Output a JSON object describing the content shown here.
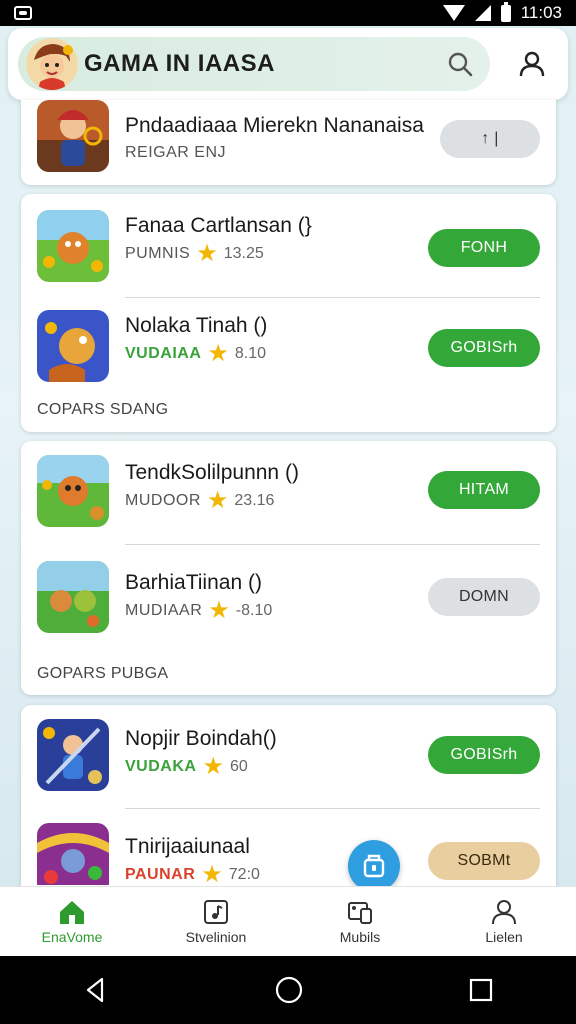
{
  "status_bar": {
    "time": "11:03"
  },
  "header": {
    "title": "GAMA  IN IAASA"
  },
  "top_card": {
    "title": "Pndaadiaaa Mierekn Nananaisa",
    "subtitle": "REIGAR ENJ",
    "button_label": "↑  |"
  },
  "card1": {
    "rows": [
      {
        "title": "Fanaa Cartlansan (}",
        "developer": "PUMNIS",
        "rating": "13.25",
        "button": "FONH"
      },
      {
        "title": "Nolaka Tinah ()",
        "developer": "VUDAIAA",
        "rating": "8.10",
        "button": "GOBISrh"
      }
    ],
    "section_label": "COPARS SDANG"
  },
  "card2": {
    "rows": [
      {
        "title": "TendkSolilpunnn ()",
        "developer": "MUDOOR",
        "rating": "23.16",
        "button": "HITAM"
      },
      {
        "title": "BarhiaTiinan ()",
        "developer": "MUDIAAR",
        "rating": "-8.10",
        "button": "DOMN"
      }
    ],
    "section_label": "GOPARS PUBGA"
  },
  "card3": {
    "rows": [
      {
        "title": "Nopjir Boindah()",
        "developer": "VUDAKA",
        "rating": "60",
        "button": "GOBISrh"
      },
      {
        "title": "Tnirijaaiunaal",
        "developer": "PAUNAR",
        "rating": "72:0",
        "button": "SOBMt"
      }
    ]
  },
  "bottom_nav": [
    {
      "label": "EnaVome"
    },
    {
      "label": "Stvelinion"
    },
    {
      "label": "Mubils"
    },
    {
      "label": "Lielen"
    }
  ],
  "colors": {
    "accent_green": "#33a738",
    "fab_blue": "#2f9ee0"
  }
}
